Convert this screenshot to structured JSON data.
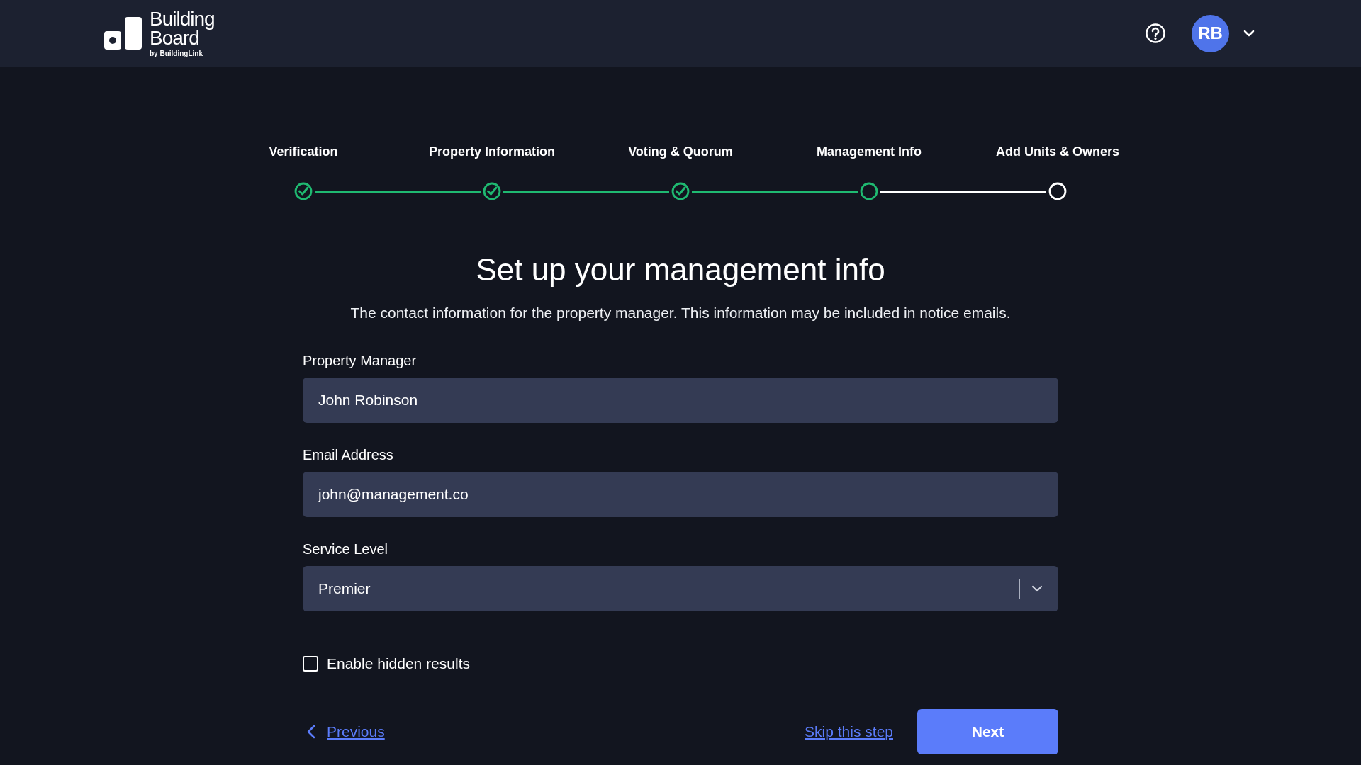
{
  "header": {
    "logo": {
      "title_line_1": "Building",
      "title_line_2": "Board",
      "byline": "by BuildingLink"
    },
    "avatar": {
      "initials": "RB"
    }
  },
  "steps": [
    {
      "label": "Verification",
      "completed": true
    },
    {
      "label": "Property Information",
      "completed": true
    },
    {
      "label": "Voting & Quorum",
      "completed": true
    },
    {
      "label": "Management Info",
      "completed": false
    },
    {
      "label": "Add Units & Owners",
      "completed": false
    }
  ],
  "heading": "Set up your management info",
  "description": "The contact information for the property manager. This information may be included in notice emails.",
  "fields": [
    {
      "kind": "text",
      "label": "Property Manager",
      "value": "John Robinson"
    },
    {
      "kind": "text",
      "label": "Email Address",
      "value": "john@management.co"
    },
    {
      "kind": "select",
      "label": "Service Level",
      "value": "Premier"
    }
  ],
  "checkbox": {
    "label": "Enable hidden results",
    "checked": false
  },
  "footer": {
    "previous": "Previous",
    "skip": "Skip this step",
    "next": "Next"
  }
}
